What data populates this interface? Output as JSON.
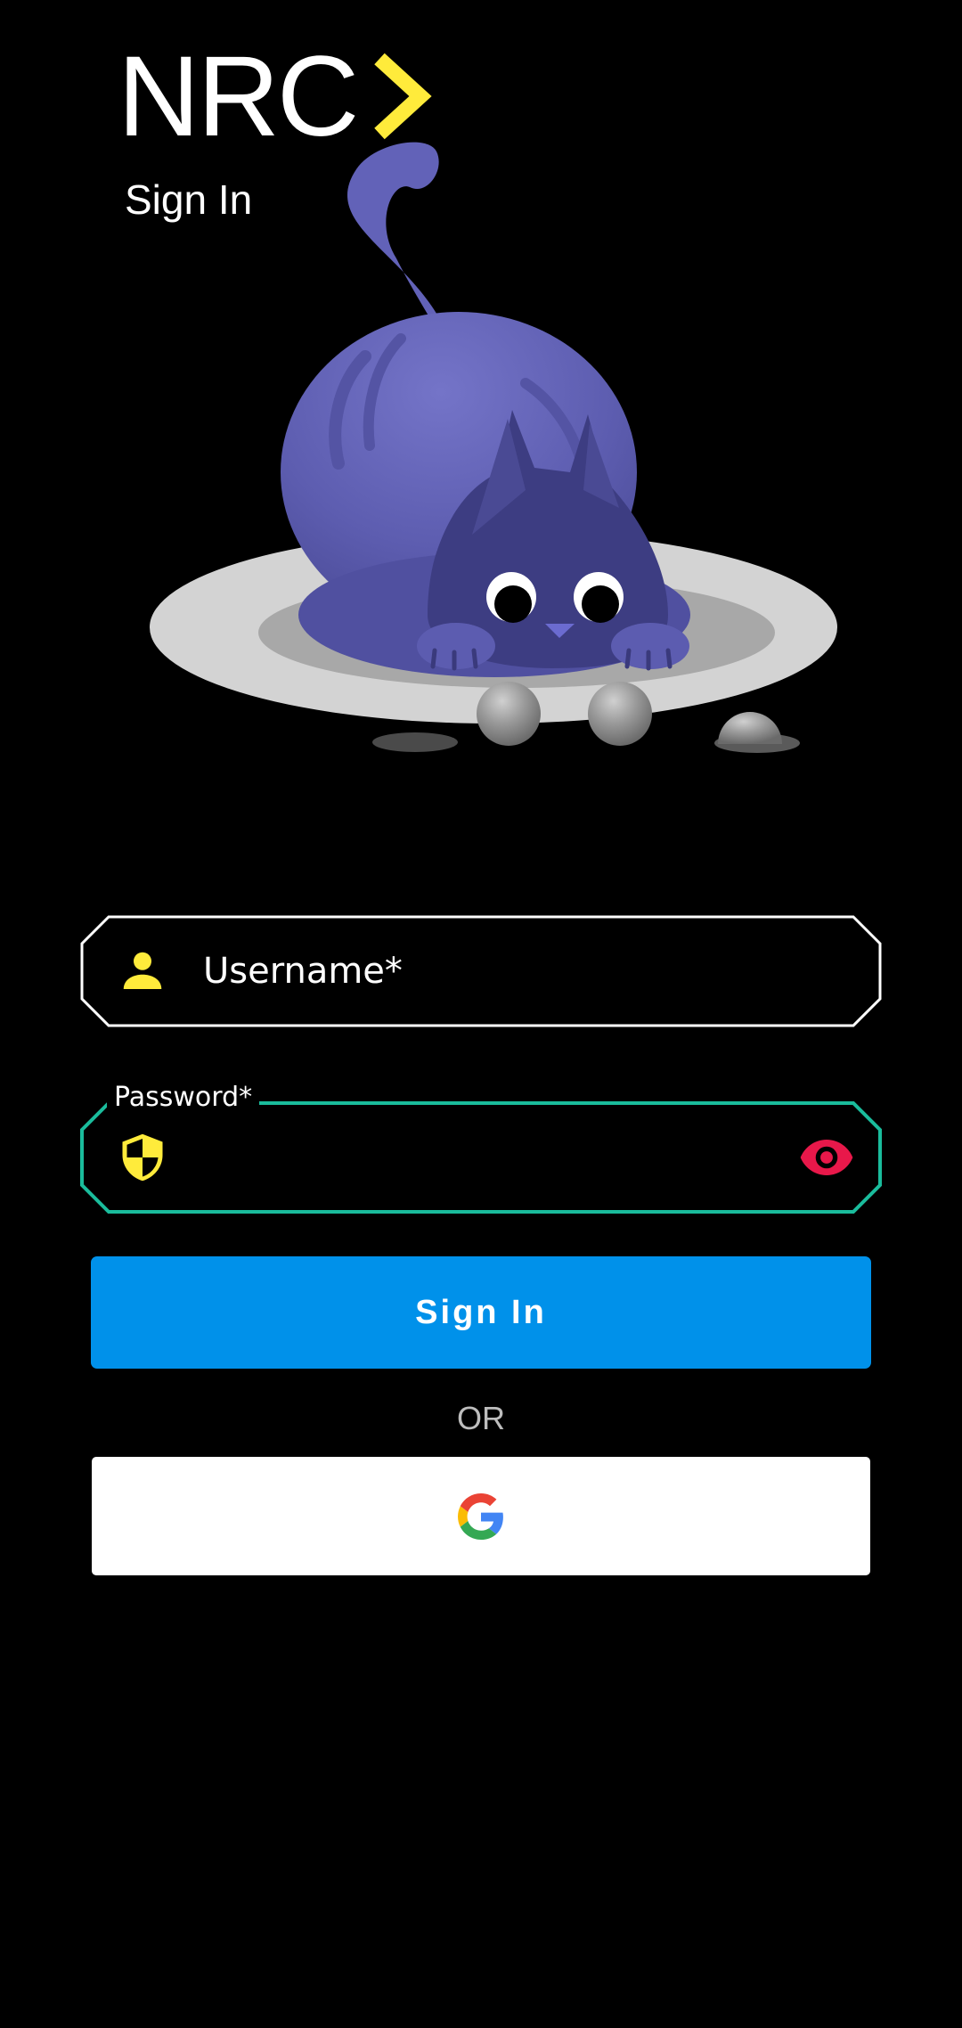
{
  "header": {
    "brand_name": "NRC",
    "subtitle": "Sign In"
  },
  "form": {
    "username": {
      "placeholder": "Username*",
      "value": "",
      "icon": "person-icon"
    },
    "password": {
      "label": "Password*",
      "value": "",
      "icon": "shield-icon",
      "toggle_icon": "eye-icon"
    },
    "sign_in_label": "Sign In",
    "divider_text": "OR",
    "google_icon": "google-icon"
  },
  "colors": {
    "background": "#000000",
    "accent_yellow": "#ffeb3b",
    "focus_teal": "#1abc9c",
    "primary_button": "#0091ea",
    "eye_red": "#e8184a",
    "cat_purple": "#5f5fb4"
  }
}
